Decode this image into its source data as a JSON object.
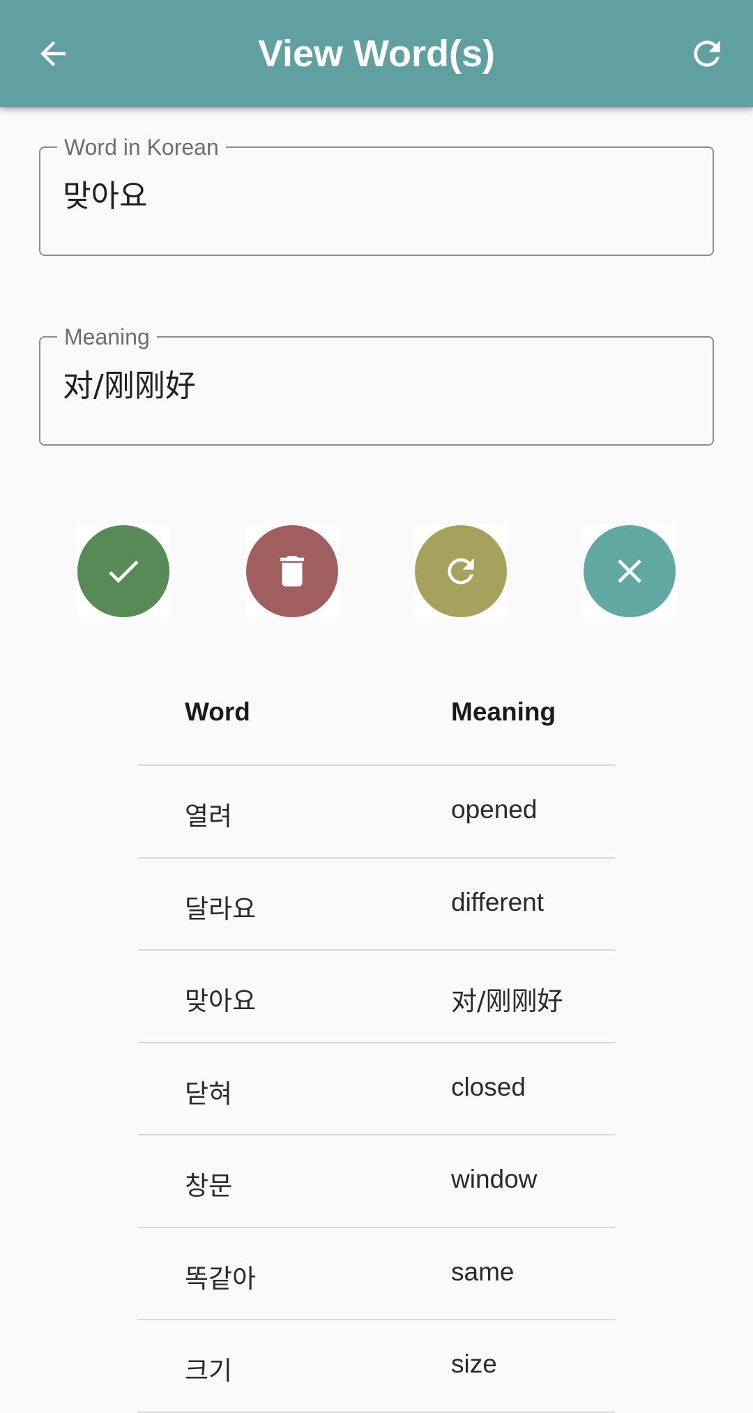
{
  "appbar": {
    "title": "View Word(s)"
  },
  "fields": {
    "korean": {
      "label": "Word in Korean",
      "value": "맞아요"
    },
    "meaning": {
      "label": "Meaning",
      "value": "对/刚刚好"
    }
  },
  "actions": {
    "confirm": {
      "icon": "check-icon",
      "color": "#578a56"
    },
    "delete": {
      "icon": "trash-icon",
      "color": "#a05e5e"
    },
    "reset": {
      "icon": "refresh-icon",
      "color": "#a6a25e"
    },
    "close": {
      "icon": "close-icon",
      "color": "#61a8a3"
    }
  },
  "table": {
    "headers": {
      "word": "Word",
      "meaning": "Meaning"
    },
    "rows": [
      {
        "word": "열려",
        "meaning": "opened"
      },
      {
        "word": "달라요",
        "meaning": "different"
      },
      {
        "word": "맞아요",
        "meaning": "对/刚刚好"
      },
      {
        "word": "닫혀",
        "meaning": "closed"
      },
      {
        "word": "창문",
        "meaning": "window"
      },
      {
        "word": "똑같아",
        "meaning": "same"
      },
      {
        "word": "크기",
        "meaning": "size"
      }
    ]
  },
  "colors": {
    "appbar": "#61a0a0",
    "background": "#fafafa"
  }
}
